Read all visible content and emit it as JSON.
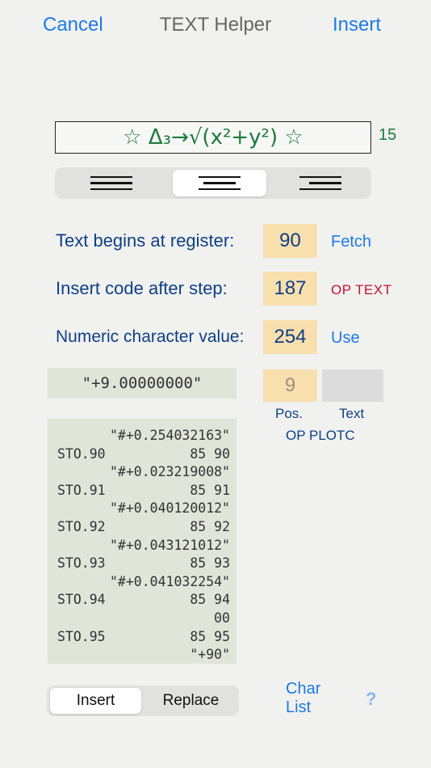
{
  "nav": {
    "cancel_label": "Cancel",
    "title": "TEXT Helper",
    "insert_label": "Insert"
  },
  "preview": {
    "text": "☆ Δ₃→√(x²+y²) ☆",
    "char_count": "15"
  },
  "alignment": {
    "options": [
      "left",
      "center",
      "right"
    ],
    "selected": "center"
  },
  "rows": [
    {
      "label": "Text begins at register:",
      "value": "90",
      "action": "Fetch"
    },
    {
      "label": "Insert code after step:",
      "value": "187",
      "action": "OP TEXT"
    },
    {
      "label": "Numeric character value:",
      "value": "254",
      "action": "Use"
    }
  ],
  "value_display": "\"+9.00000000\"",
  "position": {
    "value": "9",
    "pos_label": "Pos.",
    "text_label": "Text",
    "op_label": "OP PLOTC"
  },
  "listing": [
    {
      "left": "",
      "right": "\"#+0.254032163\""
    },
    {
      "left": "STO.90",
      "right": "85 90"
    },
    {
      "left": "",
      "right": "\"#+0.023219008\""
    },
    {
      "left": "STO.91",
      "right": "85 91"
    },
    {
      "left": "",
      "right": "\"#+0.040120012\""
    },
    {
      "left": "STO.92",
      "right": "85 92"
    },
    {
      "left": "",
      "right": "\"#+0.043121012\""
    },
    {
      "left": "STO.93",
      "right": "85 93"
    },
    {
      "left": "",
      "right": "\"#+0.041032254\""
    },
    {
      "left": "STO.94",
      "right": "85 94"
    },
    {
      "left": "",
      "right": "00"
    },
    {
      "left": "STO.95",
      "right": "85 95"
    },
    {
      "left": "",
      "right": "\"+90\""
    }
  ],
  "mode": {
    "insert_label": "Insert",
    "replace_label": "Replace",
    "selected": "Insert"
  },
  "footer": {
    "char_list_line1": "Char",
    "char_list_line2": "List",
    "help_label": "?"
  },
  "colors": {
    "accent": "#1d7ae6",
    "label_navy": "#0e3f84",
    "preview_green": "#1d7a3c",
    "input_fill": "#f8dfae",
    "listing_bg": "#e1e4d8",
    "op_text_red": "#c8102e"
  }
}
